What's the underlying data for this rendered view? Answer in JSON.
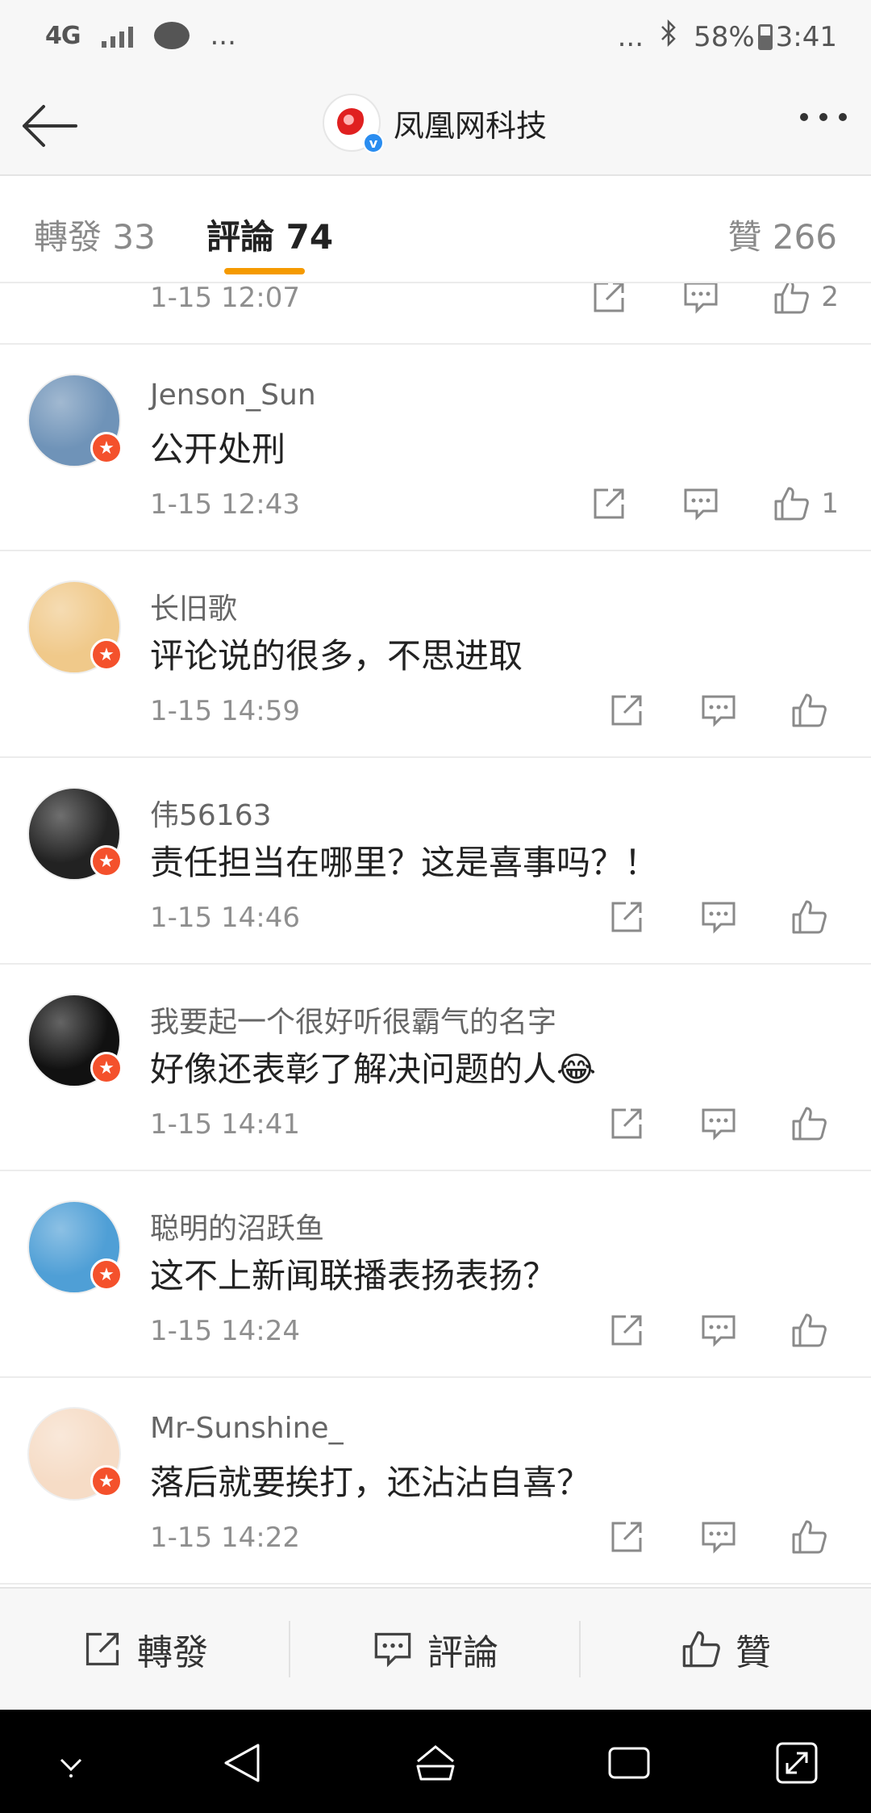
{
  "status_bar": {
    "network": "4G",
    "more": "...",
    "right_more": "...",
    "battery": "58%",
    "time": "3:41"
  },
  "header": {
    "title": "凤凰网科技",
    "avatar_icon": "ifeng-logo-icon"
  },
  "tabs": {
    "repost": "轉發 33",
    "comment": "評論 74",
    "like": "贊 266",
    "active": "comment",
    "accent": "#f59a00"
  },
  "partial_comment": {
    "time": "1-15 12:07",
    "likes": "2"
  },
  "comments": [
    {
      "user": "Jenson_Sun",
      "text": "公开处刑",
      "time": "1-15 12:43",
      "likes": "1",
      "avatar_color": "#6f93b8"
    },
    {
      "user": "长旧歌",
      "text": "评论说的很多，不思进取",
      "time": "1-15 14:59",
      "likes": "",
      "avatar_color": "#f0c98a"
    },
    {
      "user": "伟56163",
      "text": "责任担当在哪里？这是喜事吗？！",
      "time": "1-15 14:46",
      "likes": "",
      "avatar_color": "#222222"
    },
    {
      "user": "我要起一个很好听很霸气的名字",
      "text": "好像还表彰了解决问题的人😂",
      "time": "1-15 14:41",
      "likes": "",
      "avatar_color": "#111111"
    },
    {
      "user": "聪明的沼跃鱼",
      "text": "这不上新闻联播表扬表扬？",
      "time": "1-15 14:24",
      "likes": "",
      "avatar_color": "#4f9fd6"
    },
    {
      "user": "Mr-Sunshine_",
      "text": "落后就要挨打，还沾沾自喜？",
      "time": "1-15 14:22",
      "likes": "",
      "avatar_color": "#f6dcc6"
    }
  ],
  "bottom_bar": {
    "repost": "轉發",
    "comment": "評論",
    "like": "贊"
  }
}
